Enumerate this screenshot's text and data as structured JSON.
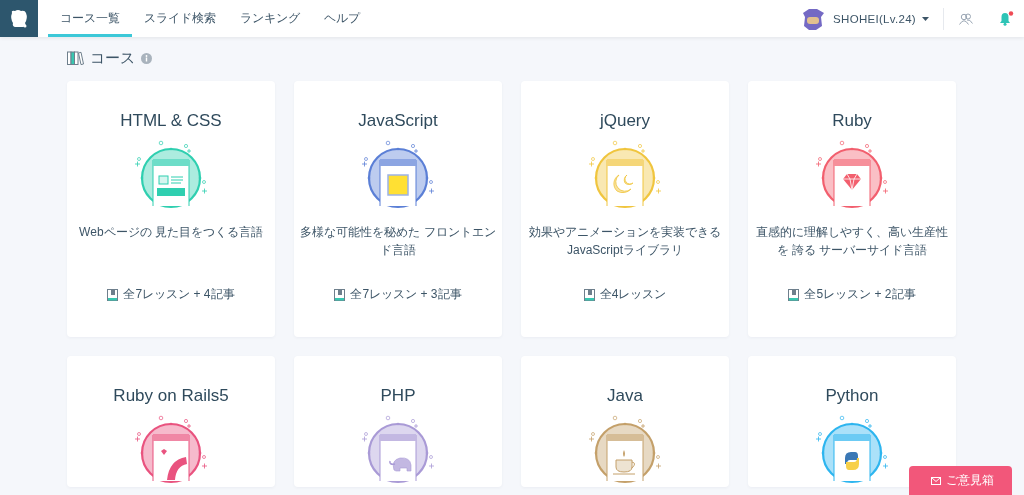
{
  "header": {
    "nav": [
      {
        "label": "コース一覧",
        "selected": true
      },
      {
        "label": "スライド検索",
        "selected": false
      },
      {
        "label": "ランキング",
        "selected": false
      },
      {
        "label": "ヘルプ",
        "selected": false
      }
    ],
    "user": {
      "name": "SHOHEI(Lv.24)"
    },
    "notifications": {
      "unread": true
    }
  },
  "section": {
    "title": "コース"
  },
  "courses": [
    {
      "title": "HTML & CSS",
      "kind": "web",
      "color": "#2fcfb0",
      "description": "Webページの 見た目をつくる言語",
      "lessons": "全7レッスン + 4記事"
    },
    {
      "title": "JavaScript",
      "kind": "es6",
      "color": "#5b7fd6",
      "description": "多様な可能性を秘めた フロントエンド言語",
      "lessons": "全7レッスン + 3記事"
    },
    {
      "title": "jQuery",
      "kind": "jquery",
      "color": "#f0c53e",
      "description": "効果やアニメーションを実装できる JavaScriptライブラリ",
      "lessons": "全4レッスン"
    },
    {
      "title": "Ruby",
      "kind": "gem",
      "color": "#f25f6e",
      "description": "直感的に理解しやすく、高い生産性を 誇る サーバーサイド言語",
      "lessons": "全5レッスン + 2記事"
    },
    {
      "title": "Ruby on Rails5",
      "kind": "rails",
      "color": "#e9537f"
    },
    {
      "title": "PHP",
      "kind": "elephant",
      "color": "#a99ad6"
    },
    {
      "title": "Java",
      "kind": "coffee",
      "color": "#c4a06a"
    },
    {
      "title": "Python",
      "kind": "python",
      "color": "#2db5ef"
    }
  ],
  "feedback_button": {
    "label": "ご意見箱"
  }
}
